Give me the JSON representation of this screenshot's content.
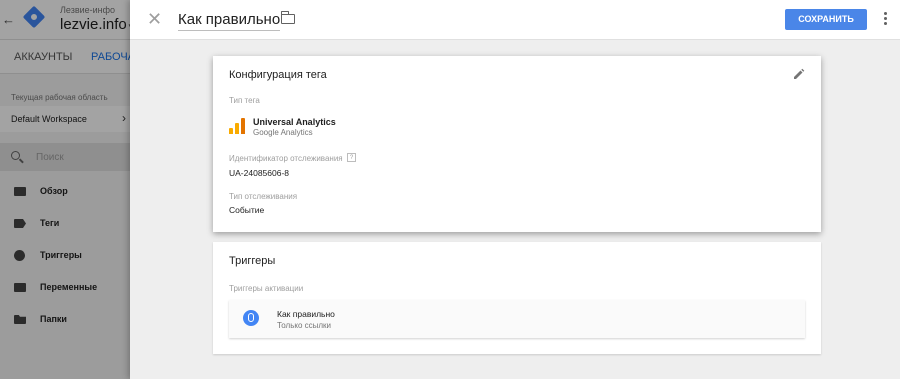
{
  "background_app": {
    "account_name": "Лезвие-инфо",
    "container_name": "lezvie.info",
    "nav_tabs": [
      {
        "label": "Аккаунты"
      },
      {
        "label": "Рабочая"
      }
    ],
    "workspace_label": "Текущая рабочая область",
    "workspace_value": "Default Workspace",
    "search_placeholder": "Поиск",
    "sidebar": {
      "items": [
        {
          "label": "Обзор",
          "icon": "overview-icon"
        },
        {
          "label": "Теги",
          "icon": "tag-icon"
        },
        {
          "label": "Триггеры",
          "icon": "trigger-icon"
        },
        {
          "label": "Переменные",
          "icon": "variable-icon"
        },
        {
          "label": "Папки",
          "icon": "folder-icon"
        }
      ]
    }
  },
  "panel": {
    "tag_name": "Как правильно",
    "save_label": "Сохранить",
    "save_color": "#4a86e8",
    "tag_config": {
      "title": "Конфигурация тега",
      "type_label": "Тип тега",
      "type_name": "Universal Analytics",
      "type_vendor": "Google Analytics",
      "tracking_id_label": "Идентификатор отслеживания",
      "tracking_id_help": "?",
      "tracking_id_value": "UA-24085606-8",
      "track_type_label": "Тип отслеживания",
      "track_type_value": "Событие"
    },
    "triggers": {
      "title": "Триггеры",
      "firing_label": "Триггеры активации",
      "items": [
        {
          "name": "Как правильно",
          "subtitle": "Только ссылки",
          "icon": "click-trigger-icon"
        }
      ]
    }
  }
}
